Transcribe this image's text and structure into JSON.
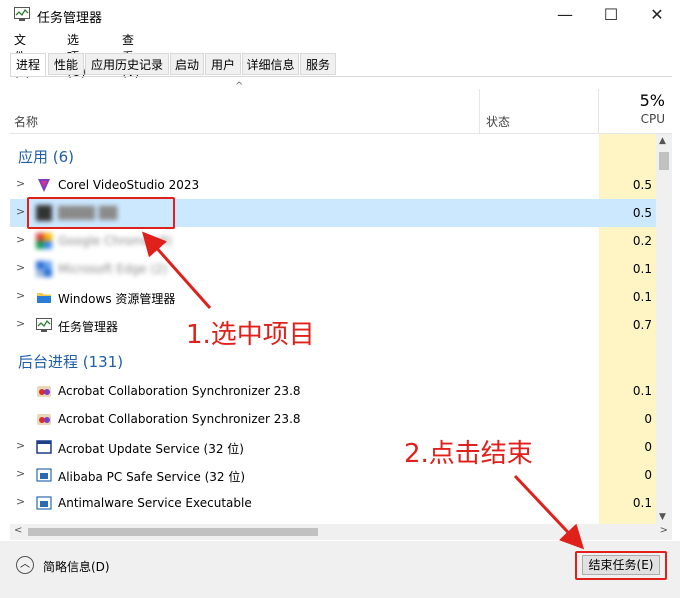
{
  "window": {
    "title": "任务管理器",
    "minimize": "—",
    "maximize": "☐",
    "close": "✕"
  },
  "menu": [
    "文件(F)",
    "选项(O)",
    "查看(V)"
  ],
  "tabs": [
    "进程",
    "性能",
    "应用历史记录",
    "启动",
    "用户",
    "详细信息",
    "服务"
  ],
  "header": {
    "sort_arrow": "^",
    "name": "名称",
    "status": "状态",
    "cpu_percent": "5%",
    "cpu": "CPU"
  },
  "groups": {
    "apps": "应用 (6)",
    "background": "后台进程 (131)"
  },
  "app_rows": [
    {
      "name": "Corel VideoStudio 2023",
      "cpu": "0.5",
      "icon": "corel-icon"
    },
    {
      "name": "████ ██",
      "cpu": "0.5",
      "icon": "blurred-app-icon",
      "selected": true
    },
    {
      "name": "Google Chrome (8)",
      "cpu": "0.2",
      "icon": "chrome-icon"
    },
    {
      "name": "Microsoft Edge (2)",
      "cpu": "0.1",
      "icon": "edge-icon"
    },
    {
      "name": "Windows 资源管理器",
      "cpu": "0.1",
      "icon": "folder-icon"
    },
    {
      "name": "任务管理器",
      "cpu": "0.7",
      "icon": "task-manager-icon"
    }
  ],
  "bg_rows": [
    {
      "name": "Acrobat Collaboration Synchronizer 23.8",
      "cpu": "0.1",
      "icon": "acrobat-icon",
      "chev": false
    },
    {
      "name": "Acrobat Collaboration Synchronizer 23.8",
      "cpu": "0",
      "icon": "acrobat-icon",
      "chev": false
    },
    {
      "name": "Acrobat Update Service (32 位)",
      "cpu": "0",
      "icon": "service-icon",
      "chev": true
    },
    {
      "name": "Alibaba PC Safe Service (32 位)",
      "cpu": "0",
      "icon": "service-icon",
      "chev": true
    },
    {
      "name": "Antimalware Service Executable",
      "cpu": "0.1",
      "icon": "service-icon",
      "chev": true
    }
  ],
  "footer": {
    "brief": "简略信息(D)",
    "end_task": "结束任务(E)"
  },
  "annotations": {
    "step1": "1.选中项目",
    "step2": "2.点击结束"
  },
  "colors": {
    "annotation": "#e0201b",
    "group_header": "#1e5fa8",
    "selected_row": "#cce8ff",
    "cpu_column": "#fff4c4"
  }
}
